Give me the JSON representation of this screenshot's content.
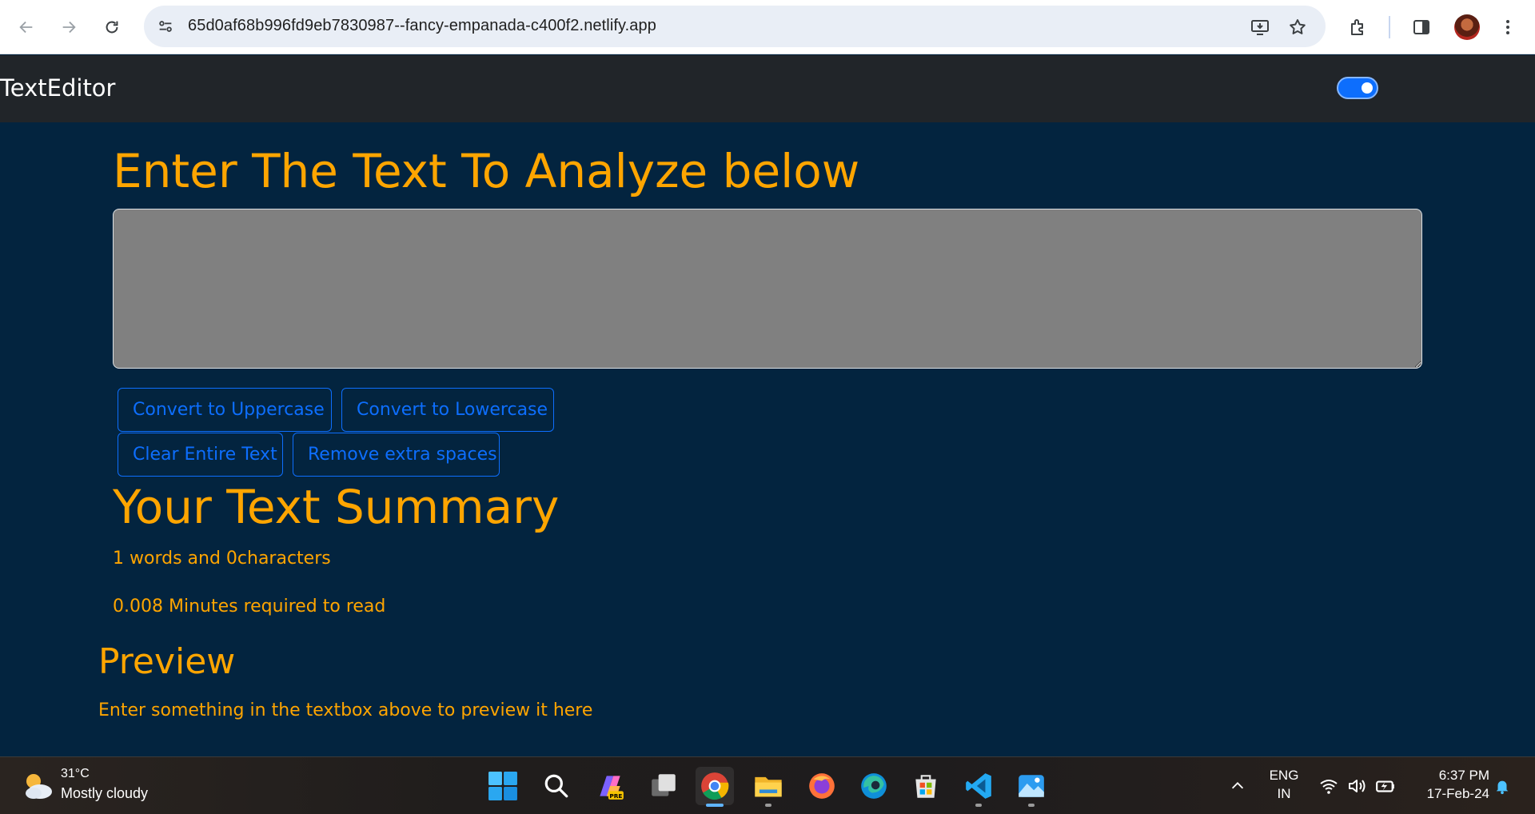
{
  "browser": {
    "url": "65d0af68b996fd9eb7830987--fancy-empanada-c400f2.netlify.app"
  },
  "navbar": {
    "brand": "TextEditor"
  },
  "main": {
    "heading": "Enter The Text To Analyze below",
    "textarea_value": "",
    "buttons": {
      "uppercase": "Convert to Uppercase",
      "lowercase": "Convert to Lowercase",
      "clear": "Clear Entire Text",
      "remove_spaces": "Remove extra spaces"
    },
    "summary_heading": "Your Text Summary",
    "word_count_text": "1 words and 0characters",
    "read_time_text": "0.008 Minutes required to read",
    "preview_heading": "Preview",
    "preview_text": "Enter something in the textbox above to preview it here"
  },
  "taskbar": {
    "weather_temp": "31°C",
    "weather_desc": "Mostly cloudy",
    "lang_top": "ENG",
    "lang_bottom": "IN",
    "time": "6:37 PM",
    "date": "17-Feb-24"
  },
  "colors": {
    "accent": "#ffa500",
    "primary": "#0d6efd",
    "page_bg": "#03243f",
    "navbar_bg": "#212529"
  }
}
